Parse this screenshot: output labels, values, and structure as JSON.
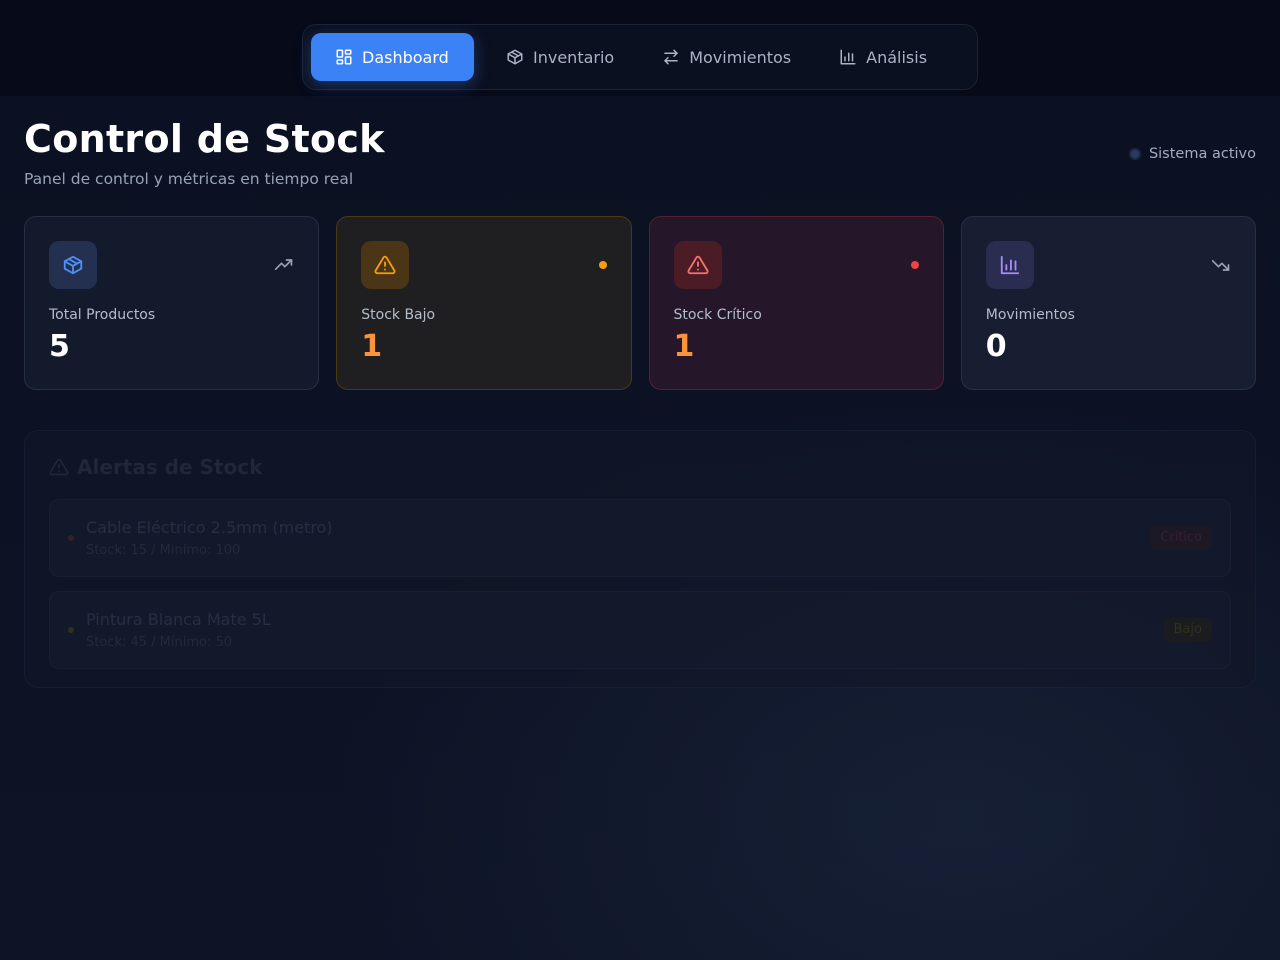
{
  "nav": {
    "tabs": [
      {
        "label": "Dashboard",
        "icon": "grid-icon",
        "active": true
      },
      {
        "label": "Inventario",
        "icon": "box-icon",
        "active": false
      },
      {
        "label": "Movimientos",
        "icon": "arrows-icon",
        "active": false
      },
      {
        "label": "Análisis",
        "icon": "bar-chart-icon",
        "active": false
      }
    ]
  },
  "header": {
    "title": "Control de Stock",
    "subtitle": "Panel de control y métricas en tiempo real",
    "status": "Sistema activo"
  },
  "cards": [
    {
      "label": "Total Productos",
      "value": "5",
      "icon": "box-icon",
      "indicator": "trending-up-icon"
    },
    {
      "label": "Stock Bajo",
      "value": "1",
      "icon": "warning-icon",
      "indicator": "amber-dot"
    },
    {
      "label": "Stock Crítico",
      "value": "1",
      "icon": "warning-icon",
      "indicator": "red-dot"
    },
    {
      "label": "Movimientos",
      "value": "0",
      "icon": "bar-chart-icon",
      "indicator": "trending-down-icon"
    }
  ],
  "alerts": {
    "title": "Alertas de Stock",
    "items": [
      {
        "name": "Cable Eléctrico 2.5mm (metro)",
        "meta": "Stock: 15 / Mínimo: 100",
        "badge": "Crítico"
      },
      {
        "name": "Pintura Blanca Mate 5L",
        "meta": "Stock: 45 / Mínimo: 50",
        "badge": "Bajo"
      }
    ]
  },
  "colors": {
    "accent": "#3b82f6",
    "warning": "#f59e0b",
    "critical": "#ef4444",
    "value_warn": "#fb923c"
  }
}
